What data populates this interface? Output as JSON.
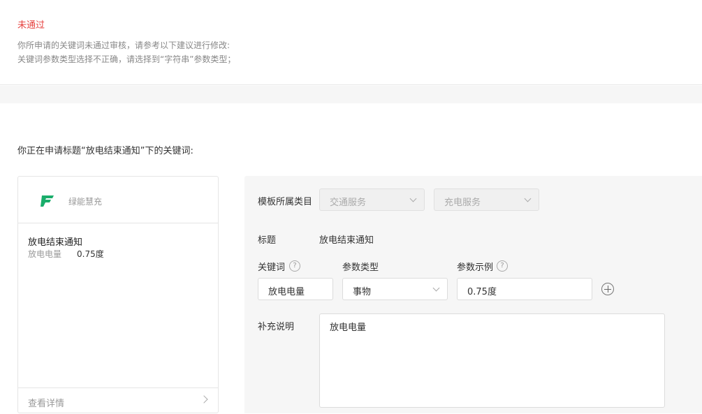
{
  "status": {
    "title": "未通过",
    "line1": "你所申请的关键词未通过审核，请参考以下建议进行修改:",
    "line2": "关键词参数类型选择不正确，请选择到“字符串”参数类型；",
    "title_color": "#e64340"
  },
  "apply_heading": "你正在申请标题“放电结束通知”下的关键词:",
  "preview": {
    "brand_name": "绿能慧充",
    "brand_color": "#1aad6b",
    "logo_icon": "brand-logo-icon",
    "title": "放电结束通知",
    "keyword_label": "放电电量",
    "keyword_value": "0.75度",
    "detail_link": "查看详情"
  },
  "form": {
    "category_label": "模板所属类目",
    "category_primary": "交通服务",
    "category_secondary": "充电服务",
    "title_label": "标题",
    "title_value": "放电结束通知",
    "keyword_label": "关键词",
    "param_type_label": "参数类型",
    "param_example_label": "参数示例",
    "keyword_value": "放电电量",
    "param_type_value": "事物",
    "param_example_value": "0.75度",
    "note_label": "补充说明",
    "note_value": "放电电量"
  }
}
